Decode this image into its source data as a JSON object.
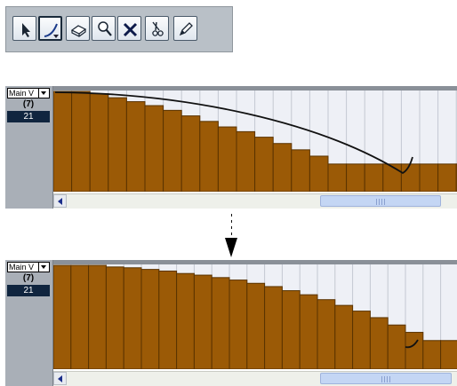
{
  "toolbar": {
    "tools": [
      {
        "name": "object-selection-tool",
        "icon": "arrow-pointer-icon",
        "active": false
      },
      {
        "name": "line-tool",
        "icon": "curve-line-icon",
        "active": true,
        "has_dropdown": true
      },
      {
        "name": "erase-tool",
        "icon": "eraser-icon",
        "active": false
      },
      {
        "name": "zoom-tool",
        "icon": "magnifier-icon",
        "active": false
      },
      {
        "name": "mute-tool",
        "icon": "x-icon",
        "active": false
      },
      {
        "name": "split-tool",
        "icon": "scissors-icon",
        "active": false
      },
      {
        "name": "draw-tool",
        "icon": "pencil-icon",
        "active": false
      }
    ]
  },
  "editor_before": {
    "lane_selector": "Main V",
    "lane_count": "(7)",
    "lane_value": "21",
    "bar_values": [
      127,
      127,
      124,
      119,
      114,
      109,
      103,
      96,
      89,
      82,
      76,
      69,
      61,
      53,
      45,
      35,
      35,
      35,
      35,
      35,
      35,
      35,
      35,
      35
    ]
  },
  "editor_after": {
    "lane_selector": "Main V",
    "lane_count": "(7)",
    "lane_value": "21",
    "bar_values": [
      127,
      127,
      127,
      125,
      124,
      122,
      120,
      117,
      115,
      112,
      109,
      105,
      101,
      96,
      91,
      85,
      78,
      71,
      63,
      54,
      45,
      35,
      35,
      35,
      35
    ]
  },
  "colors": {
    "bar_fill": "#9b5a06",
    "bar_edge": "#5a3300",
    "grid_bg": "#eef0f6",
    "selected_value_bg": "#10253f"
  }
}
